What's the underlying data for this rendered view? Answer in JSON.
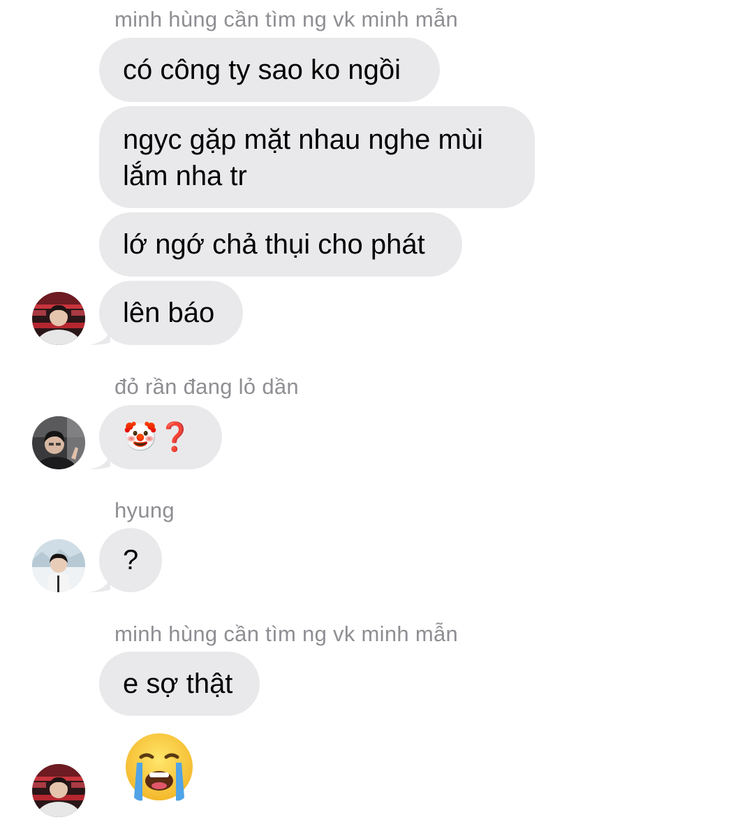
{
  "thread": {
    "groups": [
      {
        "sender": "minh hùng cần tìm ng vk minh mẫn",
        "messages": [
          "có công ty sao ko ngồi",
          "ngyc gặp mặt nhau nghe mùi",
          "lắm nha tr",
          "lớ ngớ chả thụi cho phát",
          "lên báo"
        ],
        "avatar_icon": "red-jersey-avatar-icon"
      },
      {
        "sender": "đỏ rần đang lỏ dần",
        "messages": [
          "🤡❓"
        ],
        "avatar_icon": "dark-portrait-avatar-icon"
      },
      {
        "sender": "hyung",
        "messages": [
          "?"
        ],
        "avatar_icon": "snow-portrait-avatar-icon"
      },
      {
        "sender": "minh hùng cần tìm ng vk minh mẫn",
        "messages": [
          "e sợ thật"
        ],
        "emoji_message_icon": "loudly-crying-face-icon",
        "avatar_icon": "red-jersey-avatar-icon"
      }
    ]
  },
  "colors": {
    "bubble": "#e9e9eb",
    "sender_name": "#8e8e93",
    "text": "#000000",
    "background": "#ffffff"
  }
}
